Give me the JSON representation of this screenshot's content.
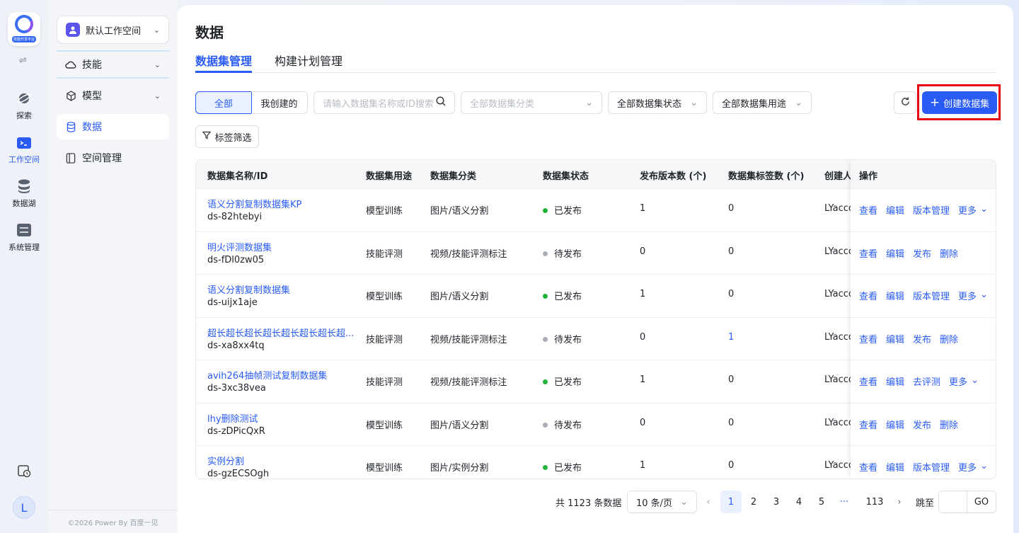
{
  "app": {
    "logo_text": "技能开发平台"
  },
  "rail": {
    "items": [
      {
        "label": "探索",
        "icon": "planet-icon"
      },
      {
        "label": "工作空间",
        "icon": "terminal-folder-icon"
      },
      {
        "label": "数据湖",
        "icon": "database-icon"
      },
      {
        "label": "系统管理",
        "icon": "settings-panel-icon"
      }
    ],
    "avatar": "L"
  },
  "sidebar": {
    "workspace": "默认工作空间",
    "items": [
      {
        "label": "技能",
        "icon": "cloud-icon"
      },
      {
        "label": "模型",
        "icon": "cube-icon"
      },
      {
        "label": "数据",
        "icon": "database-icon"
      },
      {
        "label": "空间管理",
        "icon": "book-icon"
      }
    ],
    "copyright": "©2026 Power By 百度一见"
  },
  "page": {
    "title": "数据",
    "tabs": [
      "数据集管理",
      "构建计划管理"
    ]
  },
  "filters": {
    "seg_all": "全部",
    "seg_mine": "我创建的",
    "search_placeholder": "请输入数据集名称或ID搜索",
    "category": "全部数据集分类",
    "status": "全部数据集状态",
    "usage": "全部数据集用途",
    "create": "创建数据集",
    "tag_filter": "标签筛选"
  },
  "table": {
    "headers": [
      "数据集名称/ID",
      "数据集用途",
      "数据集分类",
      "数据集状态",
      "发布版本数 (个)",
      "数据集标签数 (个)",
      "创建人",
      "操作"
    ],
    "rows": [
      {
        "name": "语义分割复制数据集KP",
        "id": "ds-82htebyi",
        "usage": "模型训练",
        "category": "图片/语义分割",
        "status": "已发布",
        "versions": "1",
        "tags": "0",
        "creator": "LYaccount",
        "ops": [
          "查看",
          "编辑",
          "版本管理",
          "更多"
        ]
      },
      {
        "name": "明火评测数据集",
        "id": "ds-fDl0zw05",
        "usage": "技能评测",
        "category": "视频/技能评测标注",
        "status": "待发布",
        "versions": "0",
        "tags": "0",
        "creator": "LYaccount",
        "ops": [
          "查看",
          "编辑",
          "发布",
          "删除"
        ]
      },
      {
        "name": "语义分割复制数据集",
        "id": "ds-uijx1aje",
        "usage": "模型训练",
        "category": "图片/语义分割",
        "status": "已发布",
        "versions": "1",
        "tags": "0",
        "creator": "LYaccount",
        "ops": [
          "查看",
          "编辑",
          "版本管理",
          "更多"
        ]
      },
      {
        "name": "超长超长超长超长超长超长超长超...",
        "id": "ds-xa8xx4tq",
        "usage": "技能评测",
        "category": "视频/技能评测标注",
        "status": "待发布",
        "versions": "0",
        "tags": "1",
        "creator": "LYaccount",
        "ops": [
          "查看",
          "编辑",
          "发布",
          "删除"
        ]
      },
      {
        "name": "avih264抽帧测试复制数据集",
        "id": "ds-3xc38vea",
        "usage": "技能评测",
        "category": "视频/技能评测标注",
        "status": "已发布",
        "versions": "1",
        "tags": "0",
        "creator": "LYaccount",
        "ops": [
          "查看",
          "编辑",
          "去评测",
          "更多"
        ]
      },
      {
        "name": "lhy删除测试",
        "id": "ds-zDPicQxR",
        "usage": "模型训练",
        "category": "图片/语义分割",
        "status": "待发布",
        "versions": "0",
        "tags": "0",
        "creator": "LYaccount",
        "ops": [
          "查看",
          "编辑",
          "发布",
          "删除"
        ]
      },
      {
        "name": "实例分割",
        "id": "ds-gzECSOgh",
        "usage": "模型训练",
        "category": "图片/实例分割",
        "status": "已发布",
        "versions": "1",
        "tags": "0",
        "creator": "LYaccount",
        "ops": [
          "查看",
          "编辑",
          "版本管理",
          "更多"
        ]
      }
    ]
  },
  "pagination": {
    "total": "共 1123 条数据",
    "page_size": "10 条/页",
    "pages": [
      "1",
      "2",
      "3",
      "4",
      "5",
      "···",
      "113"
    ],
    "jump_label": "跳至",
    "go": "GO"
  },
  "colors": {
    "accent": "#2a5cf5",
    "published": "#22b33a",
    "pending": "#a9adb5",
    "highlight": "#e60012"
  }
}
